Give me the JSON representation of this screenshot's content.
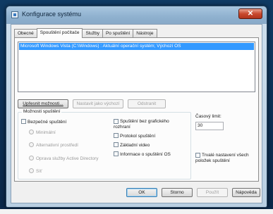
{
  "window": {
    "title": "Konfigurace systému",
    "close_glyph": "✕"
  },
  "tabs": [
    {
      "label": "Obecné",
      "active": false
    },
    {
      "label": "Spouštění počítače",
      "active": true
    },
    {
      "label": "Služby",
      "active": false
    },
    {
      "label": "Po spuštění",
      "active": false
    },
    {
      "label": "Nástroje",
      "active": false
    }
  ],
  "os_list": {
    "items": [
      "Microsoft Windows Vista (C:\\Windows) : Aktuální operační systém; Výchozí OS"
    ],
    "selected_color": "#3399ff"
  },
  "boot_buttons": {
    "advanced": "Upřesnit možnosti...",
    "set_default": "Nastavit jako výchozí",
    "delete": "Odstranit"
  },
  "boot_options": {
    "legend": "Možnosti spuštění",
    "safe_boot": "Bezpečné spuštění",
    "minimal": "Minimální",
    "alternate_shell": "Alternativní prostředí",
    "ad_repair": "Oprava služby Active Directory",
    "network": "Síť",
    "no_gui": "Spuštění bez grafického rozhraní",
    "boot_log": "Protokol spuštění",
    "base_video": "Základní video",
    "os_boot_info": "Informace o spuštění OS"
  },
  "timeout": {
    "label": "Časový limit:",
    "value": "30"
  },
  "permanent": {
    "label": "Trvalé nastavení všech položek spuštění"
  },
  "footer": {
    "ok": "OK",
    "cancel": "Storno",
    "apply": "Použít",
    "help": "Nápověda"
  }
}
